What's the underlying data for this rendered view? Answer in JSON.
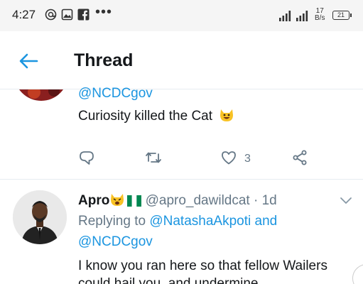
{
  "status_bar": {
    "time": "4:27",
    "dots": "•••",
    "speed_value": "17",
    "speed_unit": "B/s",
    "battery": "21"
  },
  "header": {
    "title": "Thread"
  },
  "tweet_1": {
    "mention": "@NCDCgov",
    "text": "Curiosity killed the Cat",
    "like_count": "3",
    "actions": [
      "reply-icon",
      "retweet-icon",
      "like-icon",
      "share-icon"
    ]
  },
  "tweet_2": {
    "author": "Apro",
    "handle": "@apro_dawildcat",
    "separator": "·",
    "age": "1d",
    "replying_prefix": "Replying to",
    "mention_1": "@NatashaAkpoti",
    "conjunction": "and",
    "mention_2": "@NCDCgov",
    "text": "I know you  ran here so that fellow Wailers could hail you, and undermine"
  },
  "colors": {
    "accent": "#1b95e0",
    "text_primary": "#14171a",
    "text_secondary": "#657786",
    "divider": "#e6ecf0",
    "status_bar_bg": "#f5f5f5"
  }
}
